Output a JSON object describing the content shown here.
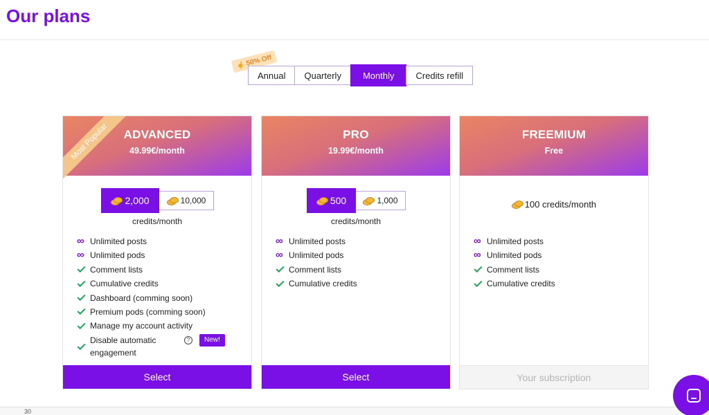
{
  "header": {
    "title": "Our plans"
  },
  "billing_tabs": {
    "badge": "50% Off",
    "items": [
      {
        "label": "Annual",
        "active": false
      },
      {
        "label": "Quarterly",
        "active": false
      },
      {
        "label": "Monthly",
        "active": true
      },
      {
        "label": "Credits refill",
        "active": false
      }
    ]
  },
  "plans": [
    {
      "name": "ADVANCED",
      "price": "49.99€/month",
      "ribbon": "Most Popular",
      "credit_options": [
        "2,000",
        "10,000"
      ],
      "selected_credit": "2,000",
      "credits_caption": "credits/month",
      "features": [
        {
          "icon": "infinity-icon",
          "text": "Unlimited posts"
        },
        {
          "icon": "check-icon",
          "text": "Unlimited pods"
        },
        {
          "icon": "check-icon",
          "text": "Comment lists"
        },
        {
          "icon": "check-icon",
          "text": "Cumulative credits"
        },
        {
          "icon": "check-icon",
          "text": "Dashboard (comming soon)"
        },
        {
          "icon": "check-icon",
          "text": "Premium pods (comming soon)"
        },
        {
          "icon": "check-icon",
          "text": "Manage my account activity"
        },
        {
          "icon": "check-icon",
          "text": "Disable automatic engagement",
          "help": "?",
          "badge": "New!"
        }
      ],
      "button": "Select"
    },
    {
      "name": "PRO",
      "price": "19.99€/month",
      "credit_options": [
        "500",
        "1,000"
      ],
      "selected_credit": "500",
      "credits_caption": "credits/month",
      "features": [
        {
          "icon": "infinity-icon",
          "text": "Unlimited posts"
        },
        {
          "icon": "infinity-icon",
          "text": "Unlimited pods"
        },
        {
          "icon": "check-icon",
          "text": "Comment lists"
        },
        {
          "icon": "check-icon",
          "text": "Cumulative credits"
        }
      ],
      "button": "Select"
    },
    {
      "name": "FREEMIUM",
      "price": "Free",
      "credits": "100 credits/month",
      "features": [
        {
          "icon": "infinity-icon",
          "text": "Unlimited posts"
        },
        {
          "icon": "infinity-icon",
          "text": "Unlimited pods"
        },
        {
          "icon": "check-icon",
          "text": "Comment lists"
        },
        {
          "icon": "check-icon",
          "text": "Cumulative credits"
        }
      ],
      "button": "Your subscription"
    }
  ],
  "background_chart": {
    "axis_label": "30"
  },
  "colors": {
    "accent": "#7a10e6",
    "check": "#1aa55b",
    "ribbon": "#f6c58a"
  }
}
